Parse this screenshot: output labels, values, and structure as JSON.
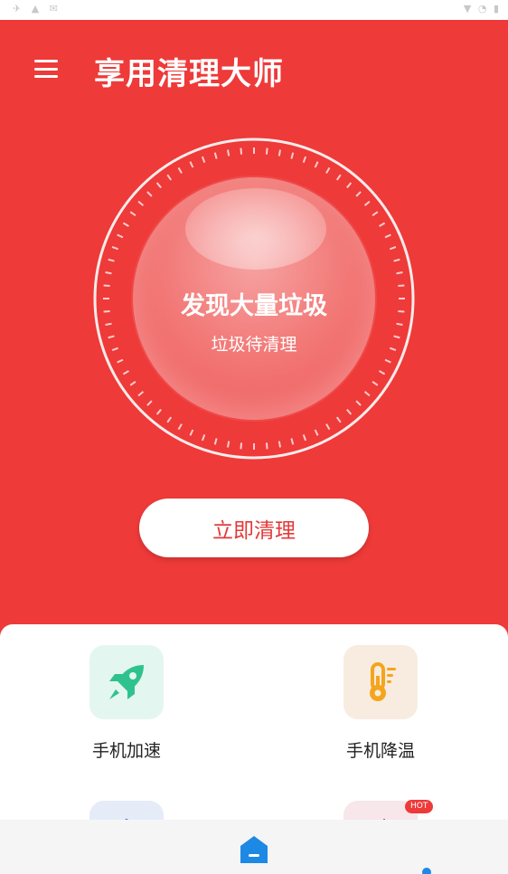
{
  "app": {
    "title": "享用清理大师"
  },
  "gauge": {
    "headline": "发现大量垃圾",
    "subtitle": "垃圾待清理"
  },
  "actions": {
    "clean_now": "立即清理"
  },
  "features": [
    {
      "label": "手机加速",
      "icon": "rocket-icon"
    },
    {
      "label": "手机降温",
      "icon": "thermometer-icon"
    },
    {
      "label": "",
      "icon": "shield-icon"
    },
    {
      "label": "",
      "icon": "chart-icon",
      "badge": "HOT"
    }
  ],
  "colors": {
    "primary": "#ee3a39",
    "button_text": "#e23a38",
    "rocket": "#2fc28e",
    "thermometer": "#f4a51c",
    "nav_home": "#1e88e5"
  }
}
